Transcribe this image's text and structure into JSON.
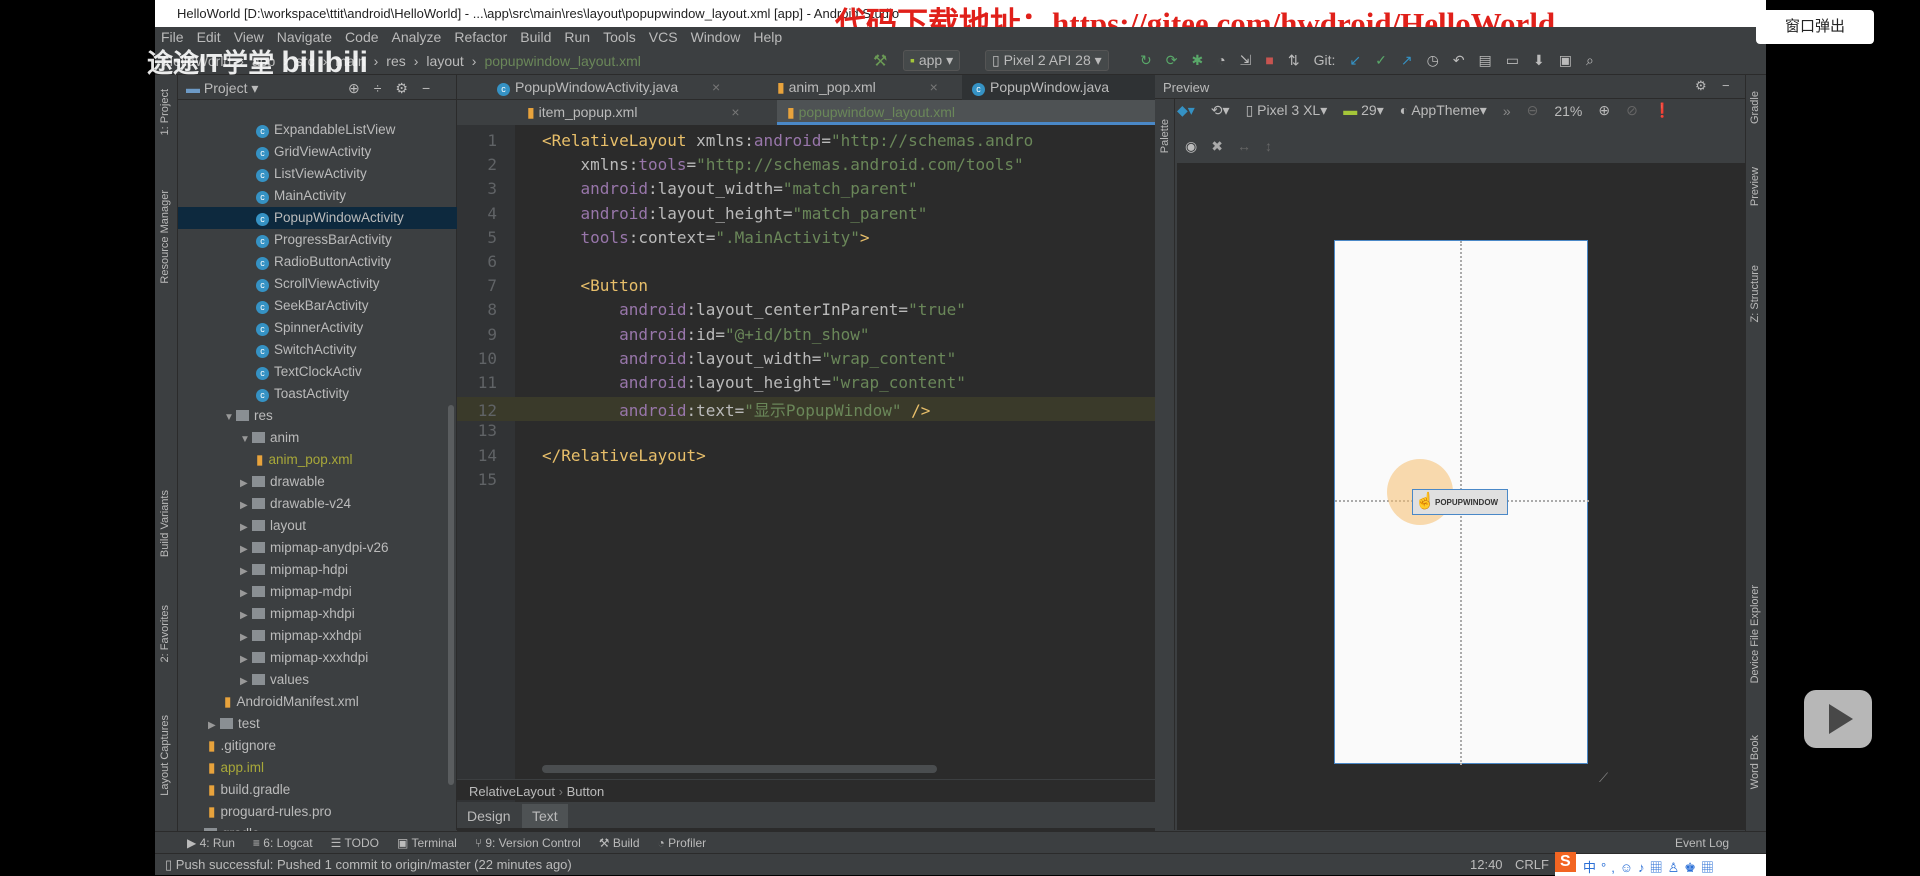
{
  "window": {
    "title": "HelloWorld [D:\\workspace\\ttit\\android\\HelloWorld] - ...\\app\\src\\main\\res\\layout\\popupwindow_layout.xml [app] - Android Studio",
    "watermark": "代码下载地址：https://gitee.com/hwdroid/HelloWorld",
    "popout_button": "窗口弹出",
    "logo_text": "途途IT学堂 bilibili"
  },
  "menu": [
    "File",
    "Edit",
    "View",
    "Navigate",
    "Code",
    "Analyze",
    "Refactor",
    "Build",
    "Run",
    "Tools",
    "VCS",
    "Window",
    "Help"
  ],
  "breadcrumb": [
    "HelloWorld",
    "app",
    "src",
    "main",
    "res",
    "layout",
    "popupwindow_layout.xml"
  ],
  "toolbar": {
    "config": "app",
    "device": "Pixel 2 API 28",
    "git": "Git:"
  },
  "left_strip": [
    "1: Project",
    "Resource Manager",
    "Build Variants",
    "2: Favorites",
    "Layout Captures"
  ],
  "project": {
    "title": "Project",
    "items": [
      {
        "label": "ExpandableListView",
        "type": "class",
        "indent": 5
      },
      {
        "label": "GridViewActivity",
        "type": "class",
        "indent": 5
      },
      {
        "label": "ListViewActivity",
        "type": "class",
        "indent": 5
      },
      {
        "label": "MainActivity",
        "type": "class",
        "indent": 5
      },
      {
        "label": "PopupWindowActivity",
        "type": "class",
        "indent": 5,
        "selected": true
      },
      {
        "label": "ProgressBarActivity",
        "type": "class",
        "indent": 5
      },
      {
        "label": "RadioButtonActivity",
        "type": "class",
        "indent": 5
      },
      {
        "label": "ScrollViewActivity",
        "type": "class",
        "indent": 5
      },
      {
        "label": "SeekBarActivity",
        "type": "class",
        "indent": 5
      },
      {
        "label": "SpinnerActivity",
        "type": "class",
        "indent": 5
      },
      {
        "label": "SwitchActivity",
        "type": "class",
        "indent": 5
      },
      {
        "label": "TextClockActiv",
        "type": "class",
        "indent": 5
      },
      {
        "label": "ToastActivity",
        "type": "class",
        "indent": 5
      },
      {
        "label": "res",
        "type": "folder",
        "indent": 3,
        "open": true
      },
      {
        "label": "anim",
        "type": "folder",
        "indent": 4,
        "open": true
      },
      {
        "label": "anim_pop.xml",
        "type": "xml",
        "indent": 5,
        "color": "#a8a839"
      },
      {
        "label": "drawable",
        "type": "folder",
        "indent": 4
      },
      {
        "label": "drawable-v24",
        "type": "folder",
        "indent": 4
      },
      {
        "label": "layout",
        "type": "folder",
        "indent": 4
      },
      {
        "label": "mipmap-anydpi-v26",
        "type": "folder",
        "indent": 4
      },
      {
        "label": "mipmap-hdpi",
        "type": "folder",
        "indent": 4
      },
      {
        "label": "mipmap-mdpi",
        "type": "folder",
        "indent": 4
      },
      {
        "label": "mipmap-xhdpi",
        "type": "folder",
        "indent": 4
      },
      {
        "label": "mipmap-xxhdpi",
        "type": "folder",
        "indent": 4
      },
      {
        "label": "mipmap-xxxhdpi",
        "type": "folder",
        "indent": 4
      },
      {
        "label": "values",
        "type": "folder",
        "indent": 4
      },
      {
        "label": "AndroidManifest.xml",
        "type": "xml",
        "indent": 3
      },
      {
        "label": "test",
        "type": "folder",
        "indent": 2
      },
      {
        "label": ".gitignore",
        "type": "file",
        "indent": 2
      },
      {
        "label": "app.iml",
        "type": "file",
        "indent": 2,
        "color": "#a8a839"
      },
      {
        "label": "build.gradle",
        "type": "file",
        "indent": 2
      },
      {
        "label": "proguard-rules.pro",
        "type": "file",
        "indent": 2
      },
      {
        "label": "gradle",
        "type": "folder",
        "indent": 1
      }
    ]
  },
  "editor": {
    "tabs_row1": [
      "PopupWindowActivity.java",
      "anim_pop.xml",
      "PopupWindow.java"
    ],
    "tabs_row2": [
      "item_popup.xml",
      "popupwindow_layout.xml"
    ],
    "active_tab": "popupwindow_layout.xml",
    "lines": [
      [
        [
          "tag",
          "<RelativeLayout "
        ],
        [
          "attr",
          "xmlns:"
        ],
        [
          "ns",
          "android"
        ],
        [
          "attr",
          "="
        ],
        [
          "str",
          "\"http://schemas.andro"
        ]
      ],
      [
        [
          "attr",
          "    xmlns:"
        ],
        [
          "ns",
          "tools"
        ],
        [
          "attr",
          "="
        ],
        [
          "str",
          "\"http://schemas.android.com/tools\""
        ]
      ],
      [
        [
          "ns",
          "    android"
        ],
        [
          "attr",
          ":layout_width="
        ],
        [
          "str",
          "\"match_parent\""
        ]
      ],
      [
        [
          "ns",
          "    android"
        ],
        [
          "attr",
          ":layout_height="
        ],
        [
          "str",
          "\"match_parent\""
        ]
      ],
      [
        [
          "ns",
          "    tools"
        ],
        [
          "attr",
          ":context="
        ],
        [
          "str",
          "\".MainActivity\""
        ],
        [
          "tag",
          ">"
        ]
      ],
      [],
      [
        [
          "tag",
          "    <Button"
        ]
      ],
      [
        [
          "ns",
          "        android"
        ],
        [
          "attr",
          ":layout_centerInParent="
        ],
        [
          "str",
          "\"true\""
        ]
      ],
      [
        [
          "ns",
          "        android"
        ],
        [
          "attr",
          ":id="
        ],
        [
          "str",
          "\"@+id/btn_show\""
        ]
      ],
      [
        [
          "ns",
          "        android"
        ],
        [
          "attr",
          ":layout_width="
        ],
        [
          "str",
          "\"wrap_content\""
        ]
      ],
      [
        [
          "ns",
          "        android"
        ],
        [
          "attr",
          ":layout_height="
        ],
        [
          "str",
          "\"wrap_content\""
        ]
      ],
      [
        [
          "ns",
          "        android"
        ],
        [
          "attr",
          ":text="
        ],
        [
          "str",
          "\"显示PopupWindow\""
        ],
        [
          "tag",
          " />"
        ]
      ],
      [],
      [
        [
          "tag",
          "</RelativeLayout>"
        ]
      ],
      []
    ],
    "current_line": 12,
    "path": [
      "RelativeLayout",
      "Button"
    ],
    "mode_tabs": [
      "Design",
      "Text"
    ],
    "active_mode": "Text"
  },
  "preview": {
    "title": "Preview",
    "palette": "Palette",
    "device": "Pixel 3 XL",
    "api": "29",
    "theme": "AppTheme",
    "zoom": "21%",
    "button_text": "POPUPWINDOW"
  },
  "right_strip": [
    "Gradle",
    "Preview",
    "Z: Structure",
    "Device File Explorer",
    "Word Book"
  ],
  "tool_windows": [
    "4: Run",
    "6: Logcat",
    "TODO",
    "Terminal",
    "9: Version Control",
    "Build",
    "Profiler"
  ],
  "event_log": "Event Log",
  "status": {
    "message": "Push successful: Pushed 1 commit to origin/master (22 minutes ago)",
    "position": "12:40",
    "line_sep": "CRLF"
  }
}
